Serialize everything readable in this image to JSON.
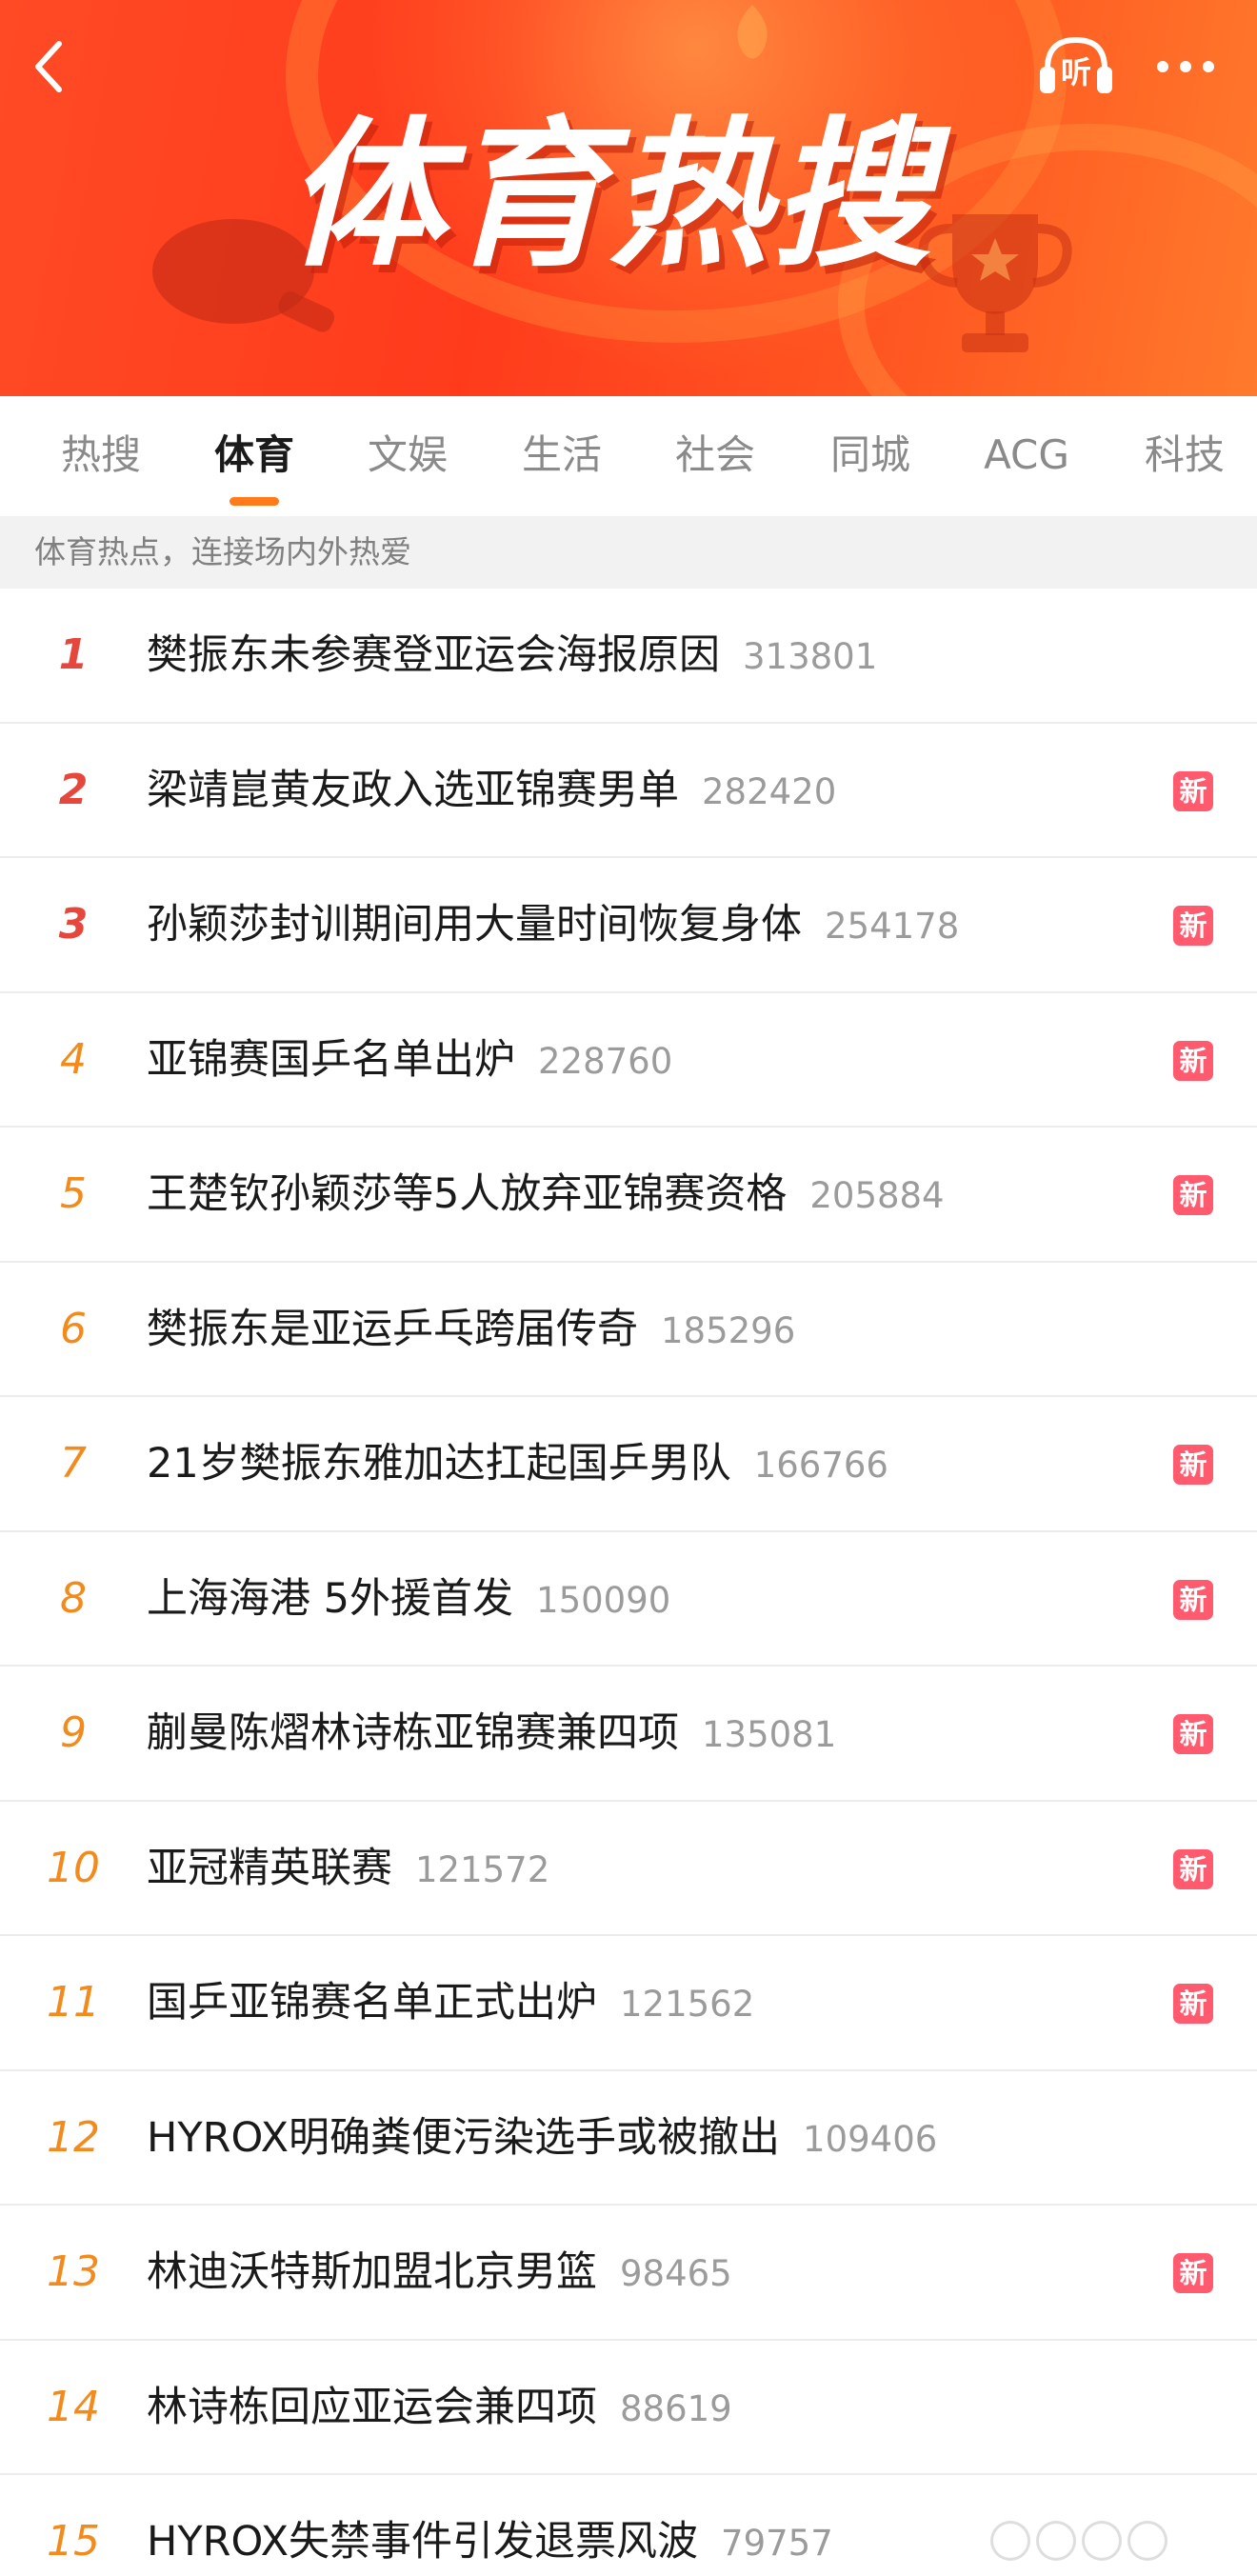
{
  "header": {
    "banner_title": "体育热搜",
    "listen_label": "听",
    "colors": {
      "banner": "#ff4a25",
      "accent": "#ff7a1a"
    }
  },
  "tabs": [
    {
      "label": "热搜",
      "active": false
    },
    {
      "label": "体育",
      "active": true
    },
    {
      "label": "文娱",
      "active": false
    },
    {
      "label": "生活",
      "active": false
    },
    {
      "label": "社会",
      "active": false
    },
    {
      "label": "同城",
      "active": false
    },
    {
      "label": "ACG",
      "active": false
    },
    {
      "label": "科技",
      "active": false
    }
  ],
  "subtitle": "体育热点，连接场内外热爱",
  "new_badge_label": "新",
  "items": [
    {
      "rank": "1",
      "title": "樊振东未参赛登亚运会海报原因",
      "count": "313801",
      "new": false
    },
    {
      "rank": "2",
      "title": "梁靖崑黄友政入选亚锦赛男单",
      "count": "282420",
      "new": true
    },
    {
      "rank": "3",
      "title": "孙颖莎封训期间用大量时间恢复身体",
      "count": "254178",
      "new": true
    },
    {
      "rank": "4",
      "title": "亚锦赛国乒名单出炉",
      "count": "228760",
      "new": true
    },
    {
      "rank": "5",
      "title": "王楚钦孙颖莎等5人放弃亚锦赛资格",
      "count": "205884",
      "new": true
    },
    {
      "rank": "6",
      "title": "樊振东是亚运乒乓跨届传奇",
      "count": "185296",
      "new": false
    },
    {
      "rank": "7",
      "title": "21岁樊振东雅加达扛起国乒男队",
      "count": "166766",
      "new": true
    },
    {
      "rank": "8",
      "title": "上海海港 5外援首发",
      "count": "150090",
      "new": true
    },
    {
      "rank": "9",
      "title": "蒯曼陈熠林诗栋亚锦赛兼四项",
      "count": "135081",
      "new": true
    },
    {
      "rank": "10",
      "title": "亚冠精英联赛",
      "count": "121572",
      "new": true
    },
    {
      "rank": "11",
      "title": "国乒亚锦赛名单正式出炉",
      "count": "121562",
      "new": true
    },
    {
      "rank": "12",
      "title": "HYROX明确粪便污染选手或被撤出",
      "count": "109406",
      "new": false
    },
    {
      "rank": "13",
      "title": "林迪沃特斯加盟北京男篮",
      "count": "98465",
      "new": true
    },
    {
      "rank": "14",
      "title": "林诗栋回应亚运会兼四项",
      "count": "88619",
      "new": false
    },
    {
      "rank": "15",
      "title": "HYROX失禁事件引发退票风波",
      "count": "79757",
      "new": false
    }
  ]
}
